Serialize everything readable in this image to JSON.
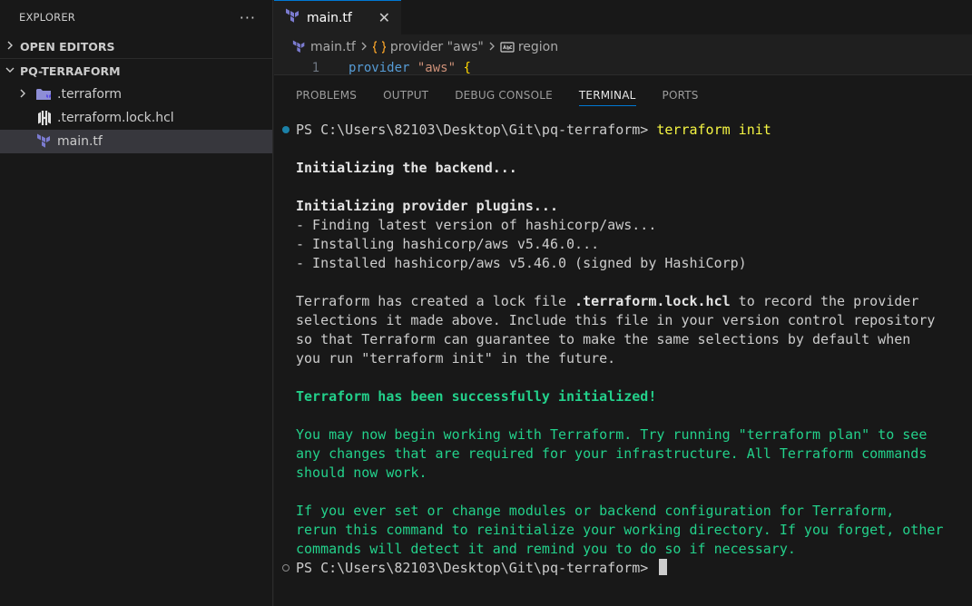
{
  "sidebar": {
    "title": "EXPLORER",
    "more": "···",
    "open_editors": "OPEN EDITORS",
    "project": "PQ-TERRAFORM",
    "items": [
      {
        "label": ".terraform",
        "icon": "folder-terraform-icon"
      },
      {
        "label": ".terraform.lock.hcl",
        "icon": "hcl-file-icon"
      },
      {
        "label": "main.tf",
        "icon": "terraform-file-icon"
      }
    ]
  },
  "tab": {
    "label": "main.tf",
    "close": "✕"
  },
  "breadcrumb": {
    "file": "main.tf",
    "block": "provider \"aws\"",
    "attr": "region"
  },
  "code": {
    "line_no": "1",
    "keyword": "provider",
    "string": "\"aws\"",
    "brace": "{"
  },
  "panel": {
    "tabs": [
      "PROBLEMS",
      "OUTPUT",
      "DEBUG CONSOLE",
      "TERMINAL",
      "PORTS"
    ],
    "active_tab": "TERMINAL"
  },
  "terminal": {
    "prompt1": "PS C:\\Users\\82103\\Desktop\\Git\\pq-terraform> ",
    "cmd1": "terraform init",
    "l_backend": "Initializing the backend...",
    "l_plugins": "Initializing provider plugins...",
    "l_find": "- Finding latest version of hashicorp/aws...",
    "l_install": "- Installing hashicorp/aws v5.46.0...",
    "l_installed": "- Installed hashicorp/aws v5.46.0 (signed by HashiCorp)",
    "l_lock_a": "Terraform has created a lock file ",
    "l_lock_b": ".terraform.lock.hcl",
    "l_lock_c": " to record the provider",
    "l_lock2": "selections it made above. Include this file in your version control repository",
    "l_lock3": "so that Terraform can guarantee to make the same selections by default when",
    "l_lock4": "you run \"terraform init\" in the future.",
    "l_success": "Terraform has been successfully initialized!",
    "l_may1": "You may now begin working with Terraform. Try running \"terraform plan\" to see",
    "l_may2": "any changes that are required for your infrastructure. All Terraform commands",
    "l_may3": "should now work.",
    "l_if1": "If you ever set or change modules or backend configuration for Terraform,",
    "l_if2": "rerun this command to reinitialize your working directory. If you forget, other",
    "l_if3": "commands will detect it and remind you to do so if necessary.",
    "prompt2": "PS C:\\Users\\82103\\Desktop\\Git\\pq-terraform> "
  },
  "colors": {
    "accent": "#0078d4",
    "terminal_green": "#23d18b",
    "terminal_yellow": "#f5f543",
    "terraform_purple": "#7b42bc"
  }
}
